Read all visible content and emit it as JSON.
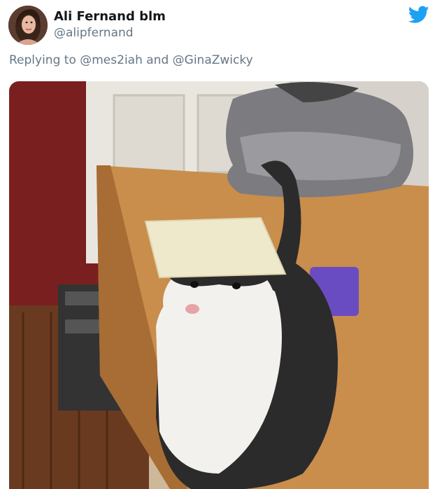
{
  "author": {
    "name": "Ali Fernand blm",
    "handle": "@alipfernand",
    "avatar_icon": "profile-photo"
  },
  "platform_icon": "twitter-bird-icon",
  "reply_context": {
    "prefix": "Replying to",
    "mention1": "@mes2iah",
    "conjunction": "and",
    "mention2": "@GinaZwicky"
  },
  "media": {
    "description_icon": "cat-photo"
  },
  "colors": {
    "twitter_blue": "#1da1f2",
    "name_text": "#14171a",
    "secondary_text": "#657786"
  }
}
